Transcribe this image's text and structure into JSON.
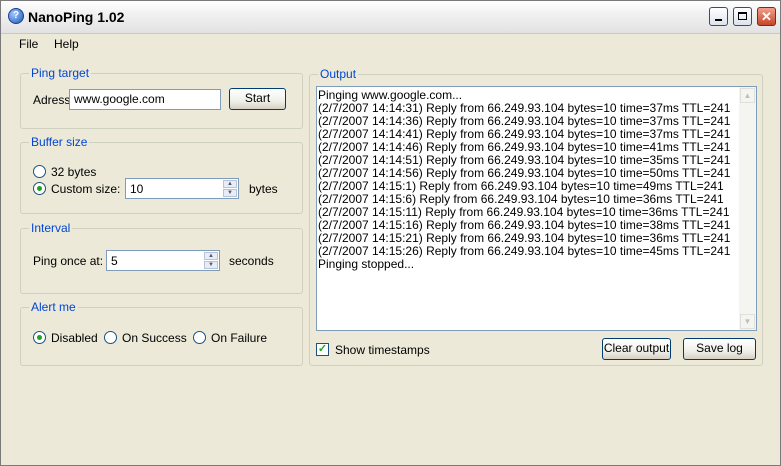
{
  "window": {
    "title": "NanoPing 1.02"
  },
  "menu": [
    "File",
    "Help"
  ],
  "ping_target": {
    "legend": "Ping  target",
    "address_label": "Adress",
    "address_value": "www.google.com",
    "start_label": "Start"
  },
  "buffer_size": {
    "legend": "Buffer size",
    "option_32": "32 bytes",
    "option_custom": "Custom size:",
    "custom_value": "10",
    "unit": "bytes",
    "selected": "custom"
  },
  "interval": {
    "legend": "Interval",
    "label": "Ping once at:",
    "value": "5",
    "unit": "seconds"
  },
  "alert": {
    "legend": "Alert me",
    "options": [
      "Disabled",
      "On Success",
      "On Failure"
    ],
    "selected": "Disabled"
  },
  "output": {
    "legend": "Output",
    "lines": [
      "Pinging www.google.com...",
      "(2/7/2007 14:14:31) Reply from 66.249.93.104  bytes=10  time=37ms  TTL=241",
      "(2/7/2007 14:14:36) Reply from 66.249.93.104  bytes=10  time=37ms  TTL=241",
      "(2/7/2007 14:14:41) Reply from 66.249.93.104  bytes=10  time=37ms  TTL=241",
      "(2/7/2007 14:14:46) Reply from 66.249.93.104  bytes=10  time=41ms  TTL=241",
      "(2/7/2007 14:14:51) Reply from 66.249.93.104  bytes=10  time=35ms  TTL=241",
      "(2/7/2007 14:14:56) Reply from 66.249.93.104  bytes=10  time=50ms  TTL=241",
      "(2/7/2007 14:15:1) Reply from 66.249.93.104  bytes=10  time=49ms  TTL=241",
      "(2/7/2007 14:15:6) Reply from 66.249.93.104  bytes=10  time=36ms  TTL=241",
      "(2/7/2007 14:15:11) Reply from 66.249.93.104  bytes=10  time=36ms  TTL=241",
      "(2/7/2007 14:15:16) Reply from 66.249.93.104  bytes=10  time=38ms  TTL=241",
      "(2/7/2007 14:15:21) Reply from 66.249.93.104  bytes=10  time=36ms  TTL=241",
      "(2/7/2007 14:15:26) Reply from 66.249.93.104  bytes=10  time=45ms  TTL=241",
      "Pinging stopped..."
    ],
    "show_timestamps_label": "Show timestamps",
    "show_timestamps_checked": true,
    "clear_label": "Clear output",
    "save_label": "Save log"
  }
}
